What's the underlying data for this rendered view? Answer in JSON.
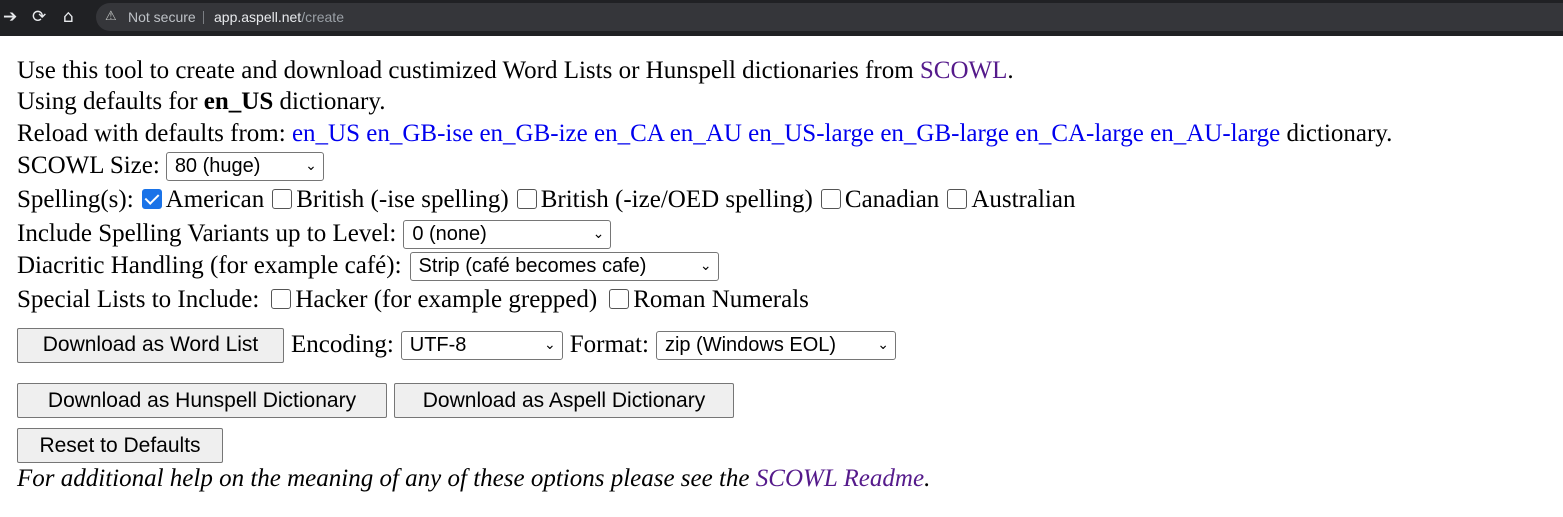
{
  "browser": {
    "back_icon": "arrow-right-icon",
    "reload_icon": "reload-icon",
    "home_icon": "home-icon",
    "security_label": "Not secure",
    "url_host": "app.aspell.net",
    "url_path": "/create"
  },
  "intro": {
    "text": "Use this tool to create and download custimized Word Lists or Hunspell dictionaries from ",
    "scowl_link": "SCOWL",
    "end": "."
  },
  "defaults": {
    "prefix": "Using defaults for ",
    "dict": "en_US",
    "suffix": " dictionary."
  },
  "reload": {
    "prefix": "Reload with defaults from: ",
    "links": [
      "en_US",
      "en_GB-ise",
      "en_GB-ize",
      "en_CA",
      "en_AU",
      "en_US-large",
      "en_GB-large",
      "en_CA-large",
      "en_AU-large"
    ],
    "suffix": " dictionary."
  },
  "size": {
    "label": "SCOWL Size:",
    "value": "80 (huge)"
  },
  "spellings": {
    "label": "Spelling(s):",
    "options": [
      {
        "label": "American",
        "checked": true
      },
      {
        "label": "British (-ise spelling)",
        "checked": false
      },
      {
        "label": "British (-ize/OED spelling)",
        "checked": false
      },
      {
        "label": "Canadian",
        "checked": false
      },
      {
        "label": "Australian",
        "checked": false
      }
    ]
  },
  "variants": {
    "label": "Include Spelling Variants up to Level:",
    "value": "0 (none)"
  },
  "diacritic": {
    "label": "Diacritic Handling (for example café):",
    "value": "Strip (café becomes cafe)"
  },
  "special": {
    "label": "Special Lists to Include:",
    "options": [
      {
        "label": "Hacker (for example grepped)",
        "checked": false
      },
      {
        "label": "Roman Numerals",
        "checked": false
      }
    ]
  },
  "download": {
    "word_list_button": "Download as Word List",
    "encoding_label": "Encoding:",
    "encoding_value": "UTF-8",
    "format_label": "Format:",
    "format_value": "zip (Windows EOL)",
    "hunspell_button": "Download as Hunspell Dictionary",
    "aspell_button": "Download as Aspell Dictionary",
    "reset_button": "Reset to Defaults"
  },
  "help": {
    "text": "For additional help on the meaning of any of these options please see the ",
    "link": "SCOWL Readme",
    "end": "."
  },
  "colors": {
    "link": "#0000ee",
    "visited_link": "#551a8b",
    "checkbox_checked": "#1a73e8"
  }
}
